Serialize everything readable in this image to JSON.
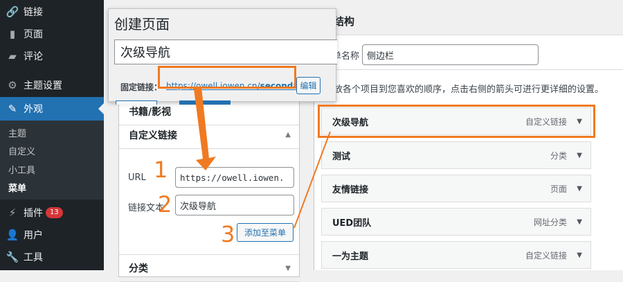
{
  "sidebar": {
    "items": [
      {
        "label": "链接",
        "icon": "link-icon"
      },
      {
        "label": "页面",
        "icon": "page-icon"
      },
      {
        "label": "评论",
        "icon": "comment-icon"
      },
      {
        "label": "主题设置",
        "icon": "gear-icon"
      },
      {
        "label": "外观",
        "icon": "paintbrush-icon"
      },
      {
        "label": "插件",
        "icon": "plugin-icon",
        "badge": "13"
      },
      {
        "label": "用户",
        "icon": "user-icon"
      },
      {
        "label": "工具",
        "icon": "wrench-icon"
      }
    ],
    "submenu": [
      "主题",
      "自定义",
      "小工具",
      "菜单"
    ]
  },
  "popup": {
    "title": "创建页面",
    "page_title_value": "次级导航",
    "permalink_label": "固定链接：",
    "permalink_base": "https://owell.iowen.cn/",
    "permalink_slug": "secondary",
    "edit_label": "编辑"
  },
  "left_panel": {
    "section_books": "书籍/影视",
    "section_custom_links": "自定义链接",
    "url_label": "URL",
    "url_value": "https://owell.iowen.",
    "link_text_label": "链接文本",
    "link_text_value": "次级导航",
    "add_button": "添加至菜单",
    "section_categories": "分类"
  },
  "right_panel": {
    "heading": "结构",
    "menu_name_label": "单名称",
    "menu_name_value": "侧边栏",
    "instructions": "放各个项目到您喜欢的顺序，点击右侧的箭头可进行更详细的设置。",
    "menu_items": [
      {
        "title": "次级导航",
        "type": "自定义链接"
      },
      {
        "title": "测试",
        "type": "分类"
      },
      {
        "title": "友情链接",
        "type": "页面"
      },
      {
        "title": "UED团队",
        "type": "网址分类"
      },
      {
        "title": "一为主题",
        "type": "自定义链接"
      }
    ]
  },
  "annotations": {
    "steps": [
      "1",
      "2",
      "3"
    ],
    "highlight_color": "#f07a22"
  }
}
